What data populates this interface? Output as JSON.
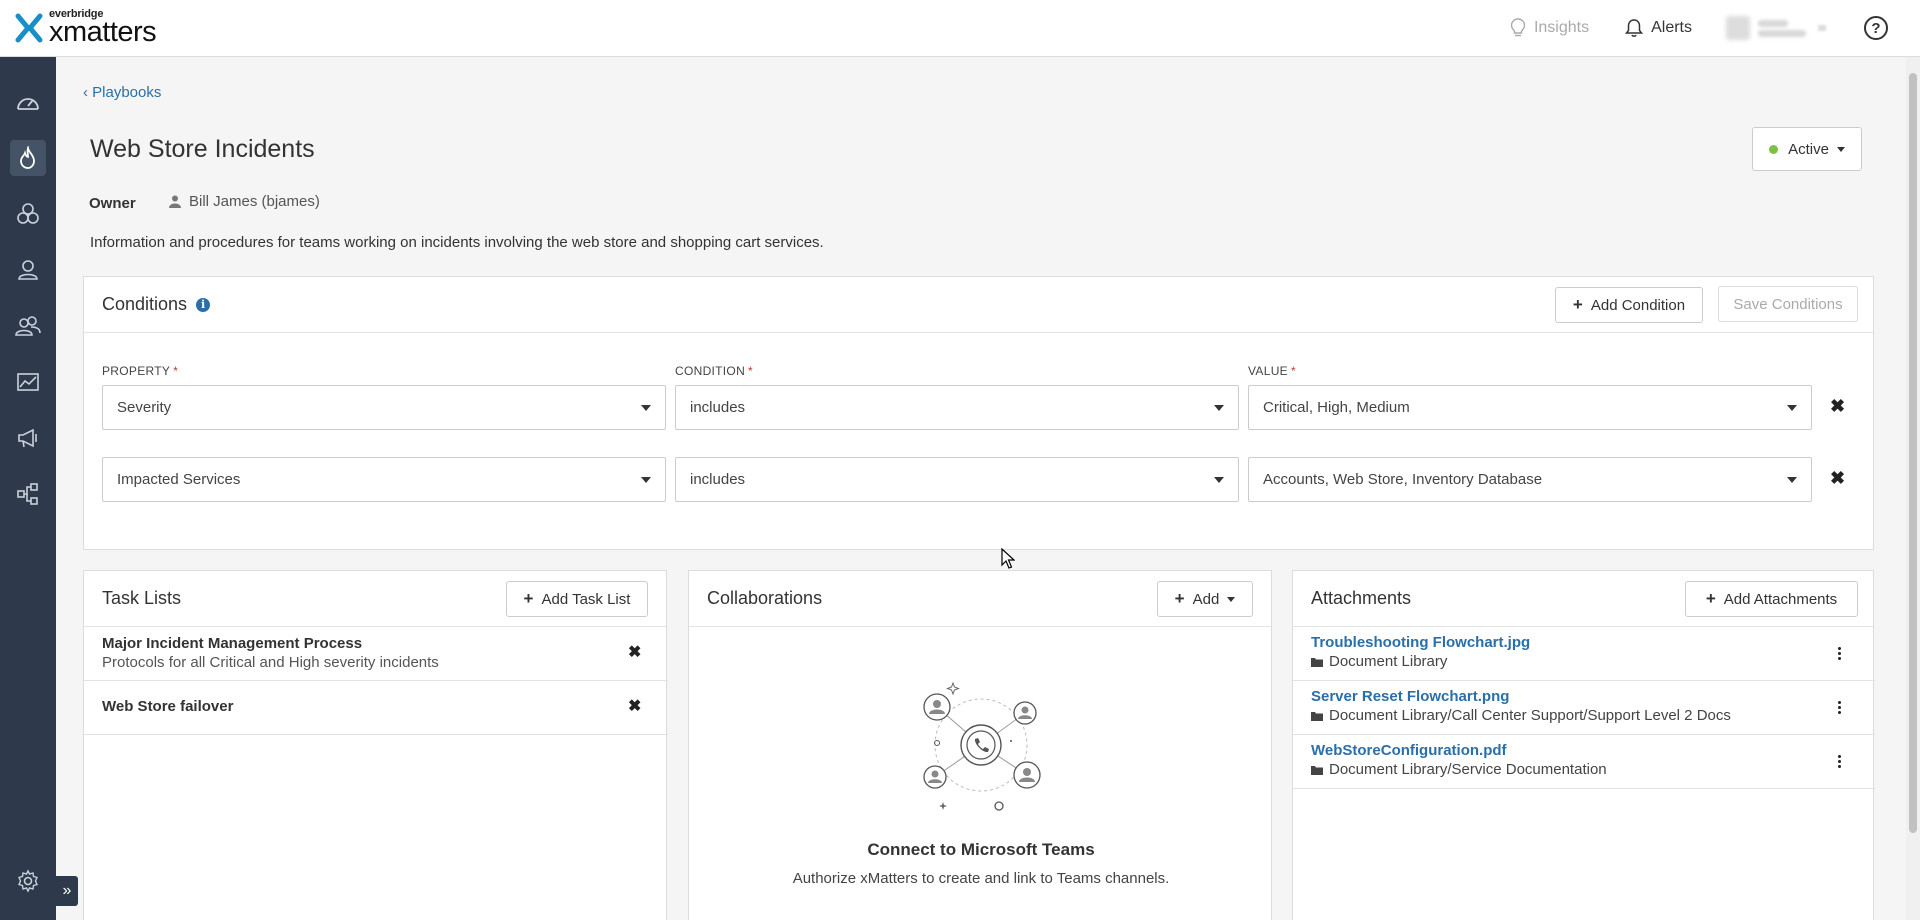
{
  "header": {
    "logo_small": "everbridge",
    "logo_big": "xmatters",
    "insights": "Insights",
    "alerts": "Alerts",
    "help": "?"
  },
  "sidebar": {
    "items": [
      "dashboard-icon",
      "flame-icon",
      "groups-icon",
      "user-icon",
      "teams-icon",
      "reports-icon",
      "megaphone-icon",
      "workflows-icon",
      "settings-icon"
    ],
    "expand": "»"
  },
  "breadcrumb": "‹ Playbooks",
  "page": {
    "title": "Web Store Incidents",
    "status": "Active",
    "owner_label": "Owner",
    "owner": "Bill James (bjames)",
    "description": "Information and procedures for teams working on incidents involving the web store and shopping cart services."
  },
  "conditions": {
    "title": "Conditions",
    "add_button": "Add Condition",
    "save_button": "Save Conditions",
    "labels": {
      "property": "PROPERTY",
      "condition": "CONDITION",
      "value": "VALUE"
    },
    "rows": [
      {
        "property": "Severity",
        "condition": "includes",
        "value": "Critical, High, Medium"
      },
      {
        "property": "Impacted Services",
        "condition": "includes",
        "value": "Accounts, Web Store, Inventory Database"
      }
    ]
  },
  "task_lists": {
    "title": "Task Lists",
    "add_button": "Add Task List",
    "items": [
      {
        "title": "Major Incident Management Process",
        "subtitle": "Protocols for all Critical and High severity incidents"
      },
      {
        "title": "Web Store failover",
        "subtitle": ""
      }
    ]
  },
  "collaborations": {
    "title": "Collaborations",
    "add_button": "Add",
    "empty_title": "Connect to Microsoft Teams",
    "empty_sub": "Authorize xMatters to create and link to Teams channels."
  },
  "attachments": {
    "title": "Attachments",
    "add_button": "Add Attachments",
    "items": [
      {
        "name": "Troubleshooting Flowchart.jpg",
        "path": "Document Library"
      },
      {
        "name": "Server Reset Flowchart.png",
        "path": "Document Library/Call Center Support/Support Level 2 Docs"
      },
      {
        "name": "WebStoreConfiguration.pdf",
        "path": "Document Library/Service Documentation"
      }
    ]
  },
  "colors": {
    "accent": "#2a6fa8",
    "sidebar": "#2e3a4b",
    "active_dot": "#7cc142",
    "logo": "#1a8fc7"
  }
}
